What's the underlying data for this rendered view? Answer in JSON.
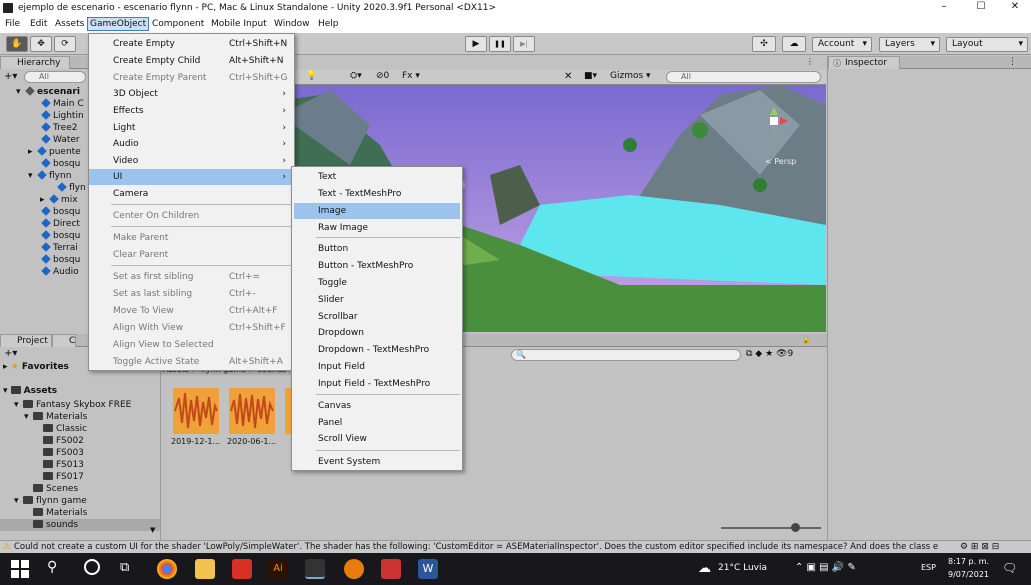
{
  "window": {
    "title": "ejemplo de escenario - escenario flynn - PC, Mac & Linux Standalone - Unity 2020.3.9f1 Personal <DX11>",
    "minimize": "–",
    "maximize": "☐",
    "close": "✕"
  },
  "menubar": [
    "File",
    "Edit",
    "Assets",
    "GameObject",
    "Component",
    "Mobile Input",
    "Window",
    "Help"
  ],
  "toolbar": {
    "play": "▶",
    "pause": "❚❚",
    "step": "▶|",
    "account": "Account",
    "layers": "Layers",
    "layout": "Layout"
  },
  "hierarchy": {
    "tab": "Hierarchy",
    "add": "+▾",
    "search_placeholder": "All",
    "items": [
      {
        "label": "escenari",
        "icon": "unity-scene"
      },
      {
        "label": "Main C",
        "icon": "cube"
      },
      {
        "label": "Lightin",
        "icon": "cube"
      },
      {
        "label": "Tree2",
        "icon": "cube"
      },
      {
        "label": "Water",
        "icon": "cube"
      },
      {
        "label": "puente",
        "icon": "cube"
      },
      {
        "label": "bosqu",
        "icon": "cube"
      },
      {
        "label": "flynn",
        "icon": "cube"
      },
      {
        "label": "flyn",
        "icon": "cube"
      },
      {
        "label": "mix",
        "icon": "cube"
      },
      {
        "label": "bosqu",
        "icon": "cube"
      },
      {
        "label": "Direct",
        "icon": "cube"
      },
      {
        "label": "bosqu",
        "icon": "cube"
      },
      {
        "label": "Terrai",
        "icon": "cube"
      },
      {
        "label": "bosqu",
        "icon": "cube"
      },
      {
        "label": "Audio",
        "icon": "cube"
      }
    ]
  },
  "scene": {
    "gizmos": "Gizmos",
    "search_placeholder": "All",
    "persp": "< Persp",
    "audio_count": "0"
  },
  "inspector": {
    "tab": "Inspector"
  },
  "project": {
    "tab": "Project",
    "tab2": "C",
    "add": "+▾",
    "favorites": "Favorites",
    "assets": "Assets",
    "tree": [
      {
        "label": "Fantasy Skybox FREE",
        "level": 1
      },
      {
        "label": "Materials",
        "level": 2
      },
      {
        "label": "Classic",
        "level": 3
      },
      {
        "label": "FS002",
        "level": 3
      },
      {
        "label": "FS003",
        "level": 3
      },
      {
        "label": "FS013",
        "level": 3
      },
      {
        "label": "FS017",
        "level": 3
      },
      {
        "label": "Scenes",
        "level": 2
      },
      {
        "label": "flynn game",
        "level": 1
      },
      {
        "label": "Materials",
        "level": 2
      },
      {
        "label": "sounds",
        "level": 2
      }
    ],
    "breadcrumb": "Assets > flynn game > sounds",
    "files": [
      "2019-12-1...",
      "2020-06-1..."
    ],
    "count": "9"
  },
  "gameobject_menu": [
    {
      "label": "Create Empty",
      "shortcut": "Ctrl+Shift+N",
      "disabled": false
    },
    {
      "label": "Create Empty Child",
      "shortcut": "Alt+Shift+N",
      "disabled": false
    },
    {
      "label": "Create Empty Parent",
      "shortcut": "Ctrl+Shift+G",
      "disabled": true
    },
    {
      "label": "3D Object",
      "shortcut": "›",
      "disabled": false
    },
    {
      "label": "Effects",
      "shortcut": "›",
      "disabled": false
    },
    {
      "label": "Light",
      "shortcut": "›",
      "disabled": false
    },
    {
      "label": "Audio",
      "shortcut": "›",
      "disabled": false
    },
    {
      "label": "Video",
      "shortcut": "›",
      "disabled": false
    },
    {
      "label": "UI",
      "shortcut": "›",
      "disabled": false
    },
    {
      "label": "Camera",
      "shortcut": "",
      "disabled": false
    },
    {
      "label": "Center On Children",
      "shortcut": "",
      "disabled": true
    },
    {
      "label": "Make Parent",
      "shortcut": "",
      "disabled": true
    },
    {
      "label": "Clear Parent",
      "shortcut": "",
      "disabled": true
    },
    {
      "label": "Set as first sibling",
      "shortcut": "Ctrl+=",
      "disabled": true
    },
    {
      "label": "Set as last sibling",
      "shortcut": "Ctrl+-",
      "disabled": true
    },
    {
      "label": "Move To View",
      "shortcut": "Ctrl+Alt+F",
      "disabled": true
    },
    {
      "label": "Align With View",
      "shortcut": "Ctrl+Shift+F",
      "disabled": true
    },
    {
      "label": "Align View to Selected",
      "shortcut": "",
      "disabled": true
    },
    {
      "label": "Toggle Active State",
      "shortcut": "Alt+Shift+A",
      "disabled": true
    }
  ],
  "ui_submenu": [
    "Text",
    "Text - TextMeshPro",
    "Image",
    "Raw Image",
    "Button",
    "Button - TextMeshPro",
    "Toggle",
    "Slider",
    "Scrollbar",
    "Dropdown",
    "Dropdown - TextMeshPro",
    "Input Field",
    "Input Field - TextMeshPro",
    "Canvas",
    "Panel",
    "Scroll View",
    "Event System"
  ],
  "status": "Could not create a custom UI for the shader 'LowPoly/SimpleWater'. The shader has the following: 'CustomEditor = ASEMaterialInspector'. Does the custom editor specified include its namespace? And does the class e",
  "taskbar": {
    "weather": "21°C Luvia",
    "lang": "ESP",
    "time": "8:17 p. m.",
    "date": "9/07/2021"
  },
  "colors": {
    "accent": "#4a78c4",
    "highlight": "#9cc3ee",
    "unity_blue": "#1f66c4",
    "water": "#5ee6ee"
  }
}
